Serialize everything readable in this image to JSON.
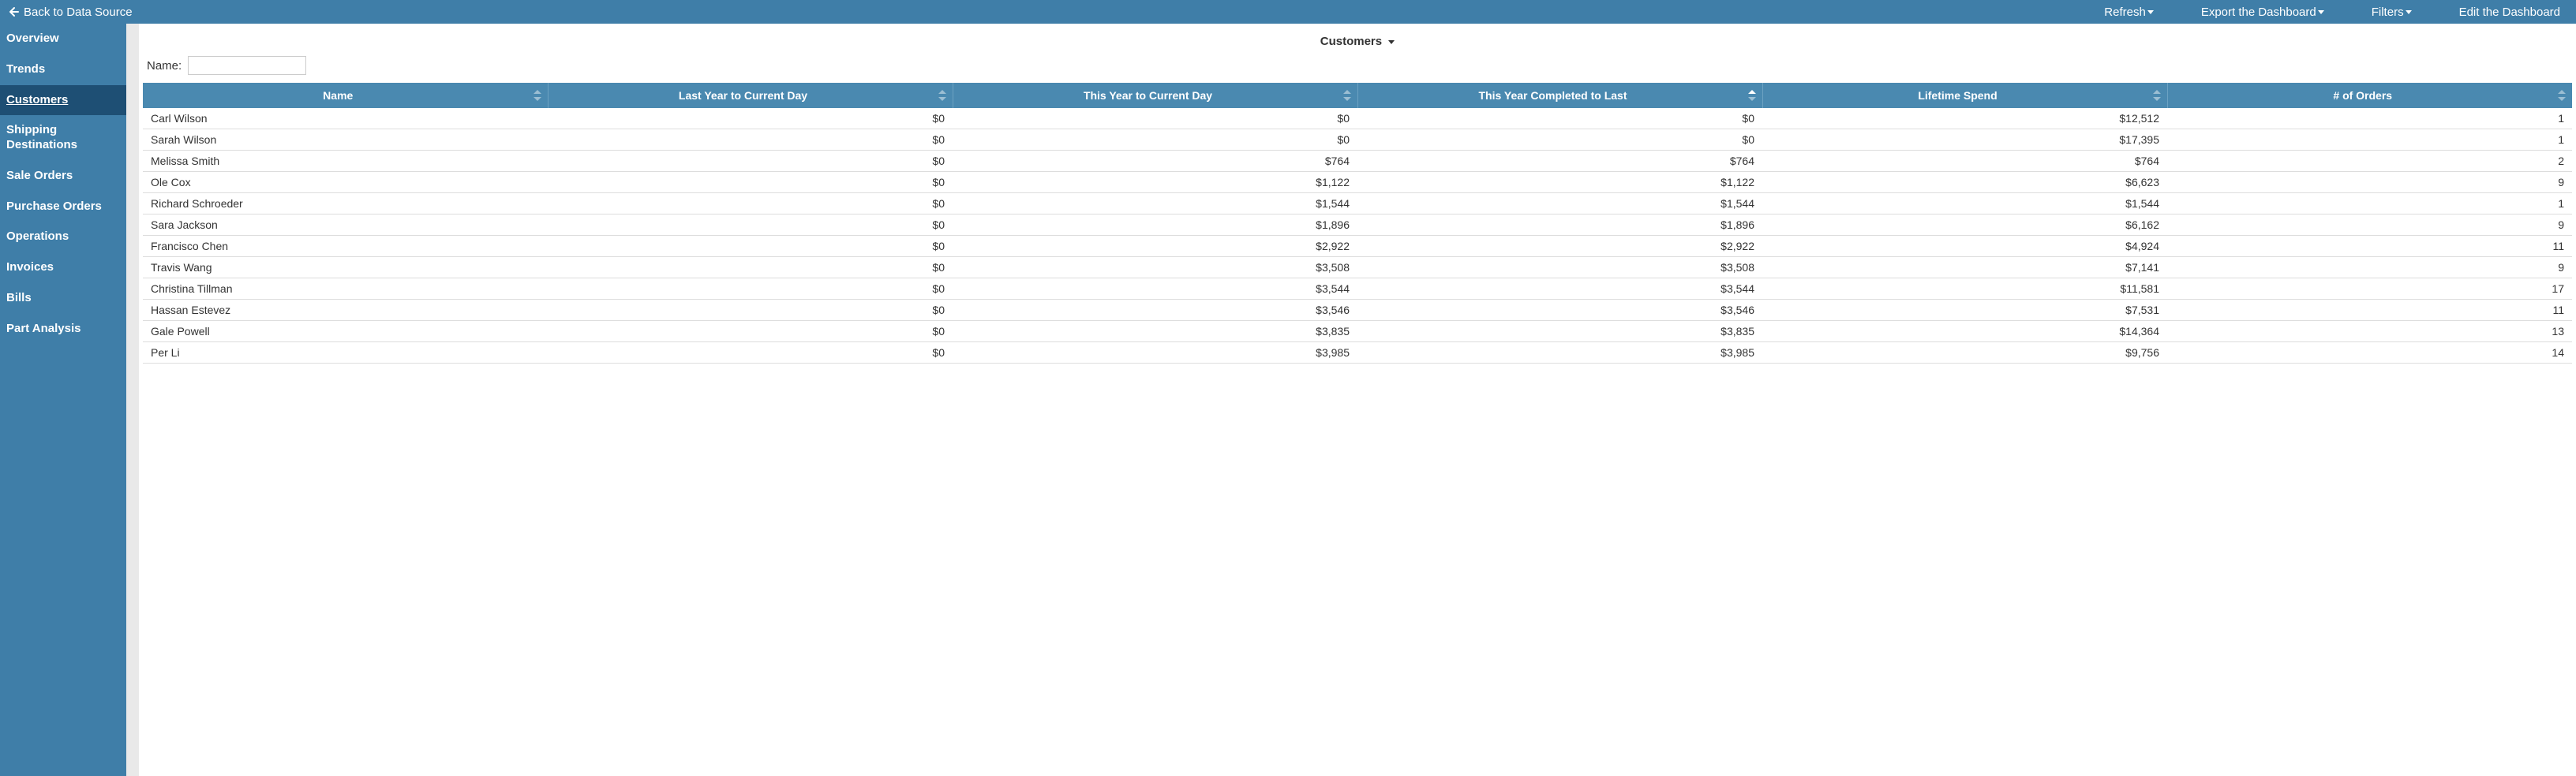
{
  "topbar": {
    "back_label": "Back to Data Source",
    "menu": [
      {
        "label": "Refresh",
        "has_caret": true
      },
      {
        "label": "Export the Dashboard",
        "has_caret": true
      },
      {
        "label": "Filters",
        "has_caret": true
      },
      {
        "label": "Edit the Dashboard",
        "has_caret": false
      }
    ]
  },
  "sidebar": {
    "items": [
      {
        "label": "Overview",
        "active": false
      },
      {
        "label": "Trends",
        "active": false
      },
      {
        "label": "Customers",
        "active": true
      },
      {
        "label": "Shipping Destinations",
        "active": false
      },
      {
        "label": "Sale Orders",
        "active": false
      },
      {
        "label": "Purchase Orders",
        "active": false
      },
      {
        "label": "Operations",
        "active": false
      },
      {
        "label": "Invoices",
        "active": false
      },
      {
        "label": "Bills",
        "active": false
      },
      {
        "label": "Part Analysis",
        "active": false
      }
    ]
  },
  "main": {
    "title": "Customers",
    "filter_label": "Name:",
    "filter_value": "",
    "columns": [
      {
        "label": "Name",
        "width": "15%",
        "sort": "none"
      },
      {
        "label": "Last Year to Current Day",
        "width": "15%",
        "sort": "none"
      },
      {
        "label": "This Year to Current Day",
        "width": "15%",
        "sort": "none"
      },
      {
        "label": "This Year Completed to Last",
        "width": "15%",
        "sort": "asc"
      },
      {
        "label": "Lifetime Spend",
        "width": "15%",
        "sort": "none"
      },
      {
        "label": "# of Orders",
        "width": "15%",
        "sort": "none"
      }
    ],
    "rows": [
      {
        "name": "Carl Wilson",
        "last_year": "$0",
        "this_year": "$0",
        "completed": "$0",
        "lifetime": "$12,512",
        "orders": "1"
      },
      {
        "name": "Sarah Wilson",
        "last_year": "$0",
        "this_year": "$0",
        "completed": "$0",
        "lifetime": "$17,395",
        "orders": "1"
      },
      {
        "name": "Melissa Smith",
        "last_year": "$0",
        "this_year": "$764",
        "completed": "$764",
        "lifetime": "$764",
        "orders": "2"
      },
      {
        "name": "Ole Cox",
        "last_year": "$0",
        "this_year": "$1,122",
        "completed": "$1,122",
        "lifetime": "$6,623",
        "orders": "9"
      },
      {
        "name": "Richard Schroeder",
        "last_year": "$0",
        "this_year": "$1,544",
        "completed": "$1,544",
        "lifetime": "$1,544",
        "orders": "1"
      },
      {
        "name": "Sara Jackson",
        "last_year": "$0",
        "this_year": "$1,896",
        "completed": "$1,896",
        "lifetime": "$6,162",
        "orders": "9"
      },
      {
        "name": "Francisco Chen",
        "last_year": "$0",
        "this_year": "$2,922",
        "completed": "$2,922",
        "lifetime": "$4,924",
        "orders": "11"
      },
      {
        "name": "Travis Wang",
        "last_year": "$0",
        "this_year": "$3,508",
        "completed": "$3,508",
        "lifetime": "$7,141",
        "orders": "9"
      },
      {
        "name": "Christina Tillman",
        "last_year": "$0",
        "this_year": "$3,544",
        "completed": "$3,544",
        "lifetime": "$11,581",
        "orders": "17"
      },
      {
        "name": "Hassan Estevez",
        "last_year": "$0",
        "this_year": "$3,546",
        "completed": "$3,546",
        "lifetime": "$7,531",
        "orders": "11"
      },
      {
        "name": "Gale Powell",
        "last_year": "$0",
        "this_year": "$3,835",
        "completed": "$3,835",
        "lifetime": "$14,364",
        "orders": "13"
      },
      {
        "name": "Per Li",
        "last_year": "$0",
        "this_year": "$3,985",
        "completed": "$3,985",
        "lifetime": "$9,756",
        "orders": "14"
      }
    ]
  }
}
